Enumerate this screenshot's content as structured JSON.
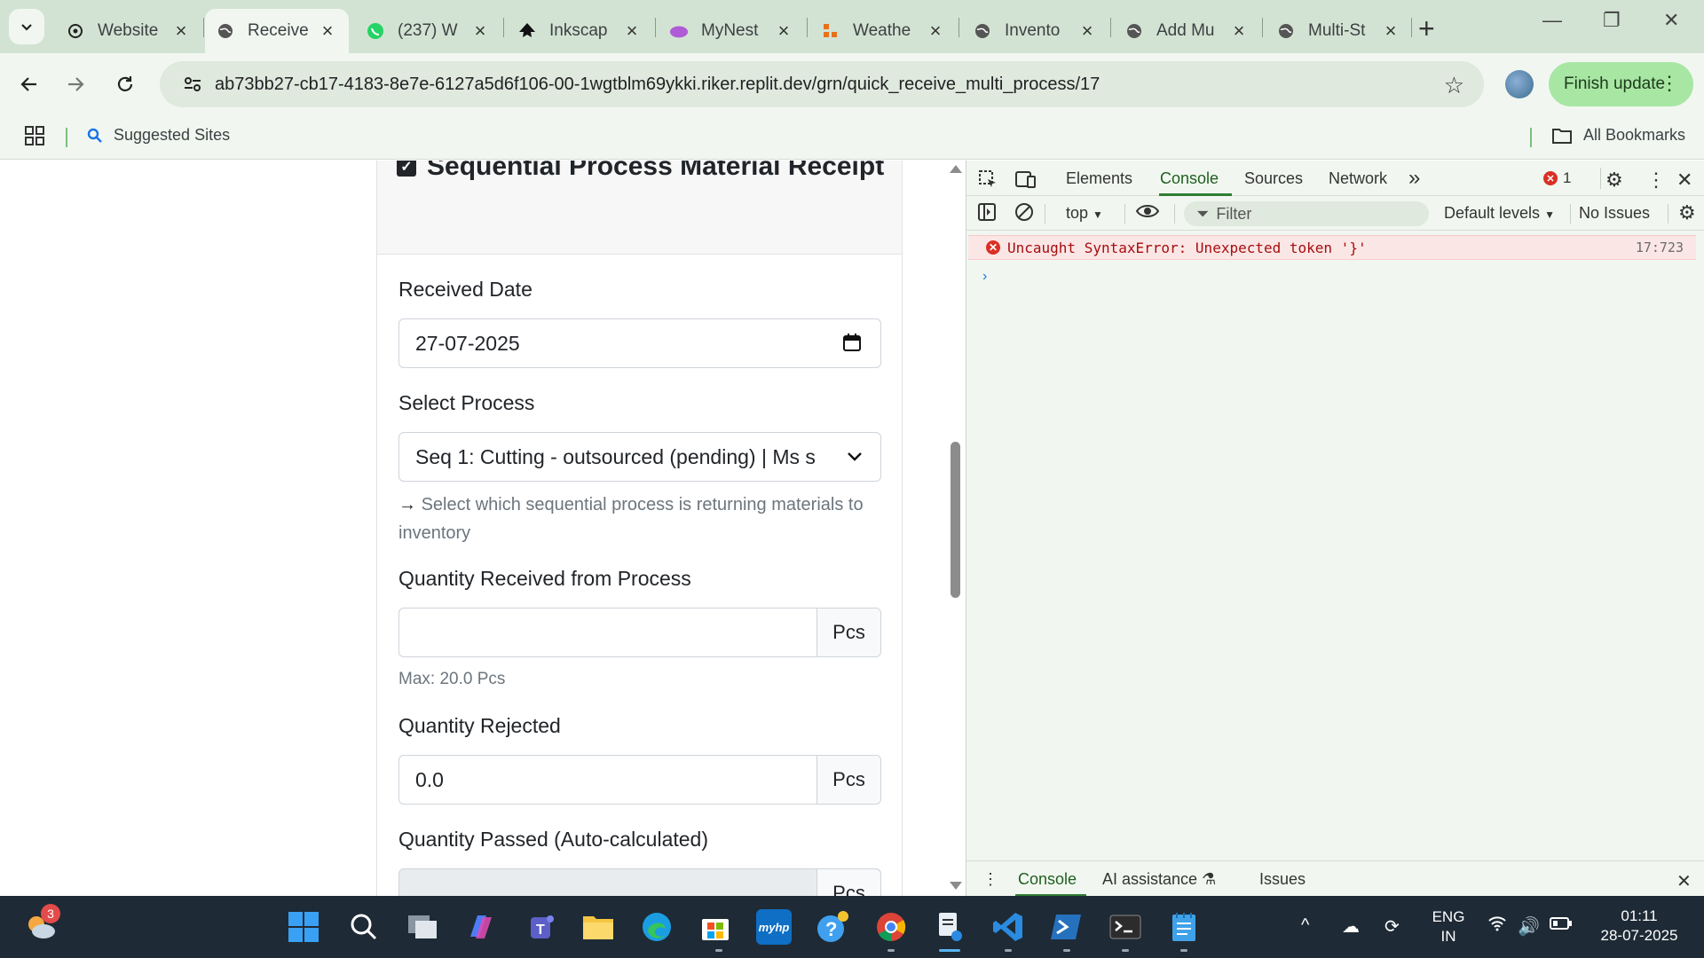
{
  "browser": {
    "tabs": [
      {
        "title": "Website",
        "icon": "openai-icon"
      },
      {
        "title": "Receive",
        "icon": "globe-icon",
        "active": true
      },
      {
        "title": "(237) W",
        "icon": "whatsapp-icon"
      },
      {
        "title": "Inkscap",
        "icon": "inkscape-icon"
      },
      {
        "title": "MyNest",
        "icon": "mynest-icon"
      },
      {
        "title": "Weathe",
        "icon": "weather-icon"
      },
      {
        "title": "Invento",
        "icon": "globe-icon"
      },
      {
        "title": "Add Mu",
        "icon": "globe-icon"
      },
      {
        "title": "Multi-St",
        "icon": "globe-icon"
      }
    ],
    "url": "ab73bb27-cb17-4183-8e7e-6127a5d6f106-00-1wgtblm69ykki.riker.replit.dev/grn/quick_receive_multi_process/17",
    "finish_update": "Finish update",
    "bookmarks": {
      "suggested": "Suggested Sites",
      "all": "All Bookmarks"
    }
  },
  "form": {
    "header_title": "Sequential Process Material Receipt",
    "received_date_label": "Received Date",
    "received_date_value": "27-07-2025",
    "select_process_label": "Select Process",
    "select_process_value": "Seq 1: Cutting - outsourced (pending) | Ms s",
    "select_process_help": "Select which sequential process is returning materials to inventory",
    "qty_received_label": "Quantity Received from Process",
    "qty_received_value": "",
    "qty_unit": "Pcs",
    "qty_max": "Max: 20.0 Pcs",
    "qty_rejected_label": "Quantity Rejected",
    "qty_rejected_value": "0.0",
    "qty_passed_label": "Quantity Passed (Auto-calculated)"
  },
  "devtools": {
    "tabs": [
      "Elements",
      "Console",
      "Sources",
      "Network"
    ],
    "active_tab": "Console",
    "error_count": "1",
    "context": "top",
    "filter_placeholder": "Filter",
    "levels": "Default levels",
    "issues": "No Issues",
    "error_message": "Uncaught SyntaxError: Unexpected token '}'",
    "error_location": "17:723",
    "drawer_tabs": [
      "Console",
      "AI assistance",
      "Issues"
    ]
  },
  "taskbar": {
    "weather_badge": "3",
    "lang_line1": "ENG",
    "lang_line2": "IN",
    "time": "01:11",
    "date": "28-07-2025"
  },
  "colors": {
    "accent_green": "#2f7d32",
    "finish_bg": "#a8e6a4",
    "error_bg": "#fbe6e6",
    "error_text": "#a50e0e"
  }
}
